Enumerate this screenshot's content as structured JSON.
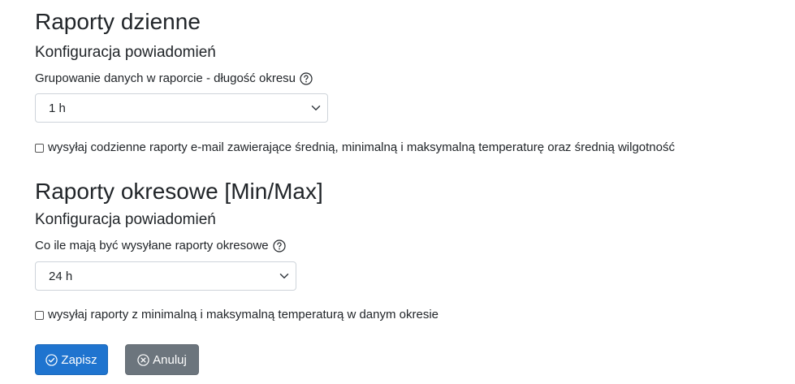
{
  "daily": {
    "title": "Raporty dzienne",
    "subtitle": "Konfiguracja powiadomień",
    "group_label": "Grupowanie danych w raporcie - długość okresu",
    "group_value": "1 h",
    "checkbox_label": "wysyłaj codzienne raporty e-mail zawierające średnią, minimalną i maksymalną temperaturę oraz średnią wilgotność",
    "checkbox_checked": false
  },
  "periodic": {
    "title": "Raporty okresowe [Min/Max]",
    "subtitle": "Konfiguracja powiadomień",
    "interval_label": "Co ile mają być wysyłane raporty okresowe",
    "interval_value": "24 h",
    "checkbox_label": "wysyłaj raporty z minimalną i maksymalną temperaturą w danym okresie",
    "checkbox_checked": false
  },
  "actions": {
    "save_label": "Zapisz",
    "cancel_label": "Anuluj"
  },
  "icons": {
    "help": "question-circle-icon",
    "chevron": "chevron-down-icon",
    "save": "check-circle-icon",
    "cancel": "x-circle-icon"
  },
  "colors": {
    "primary": "#1f74cf",
    "secondary": "#6c757d",
    "text": "#212529",
    "border": "#ced4da"
  }
}
